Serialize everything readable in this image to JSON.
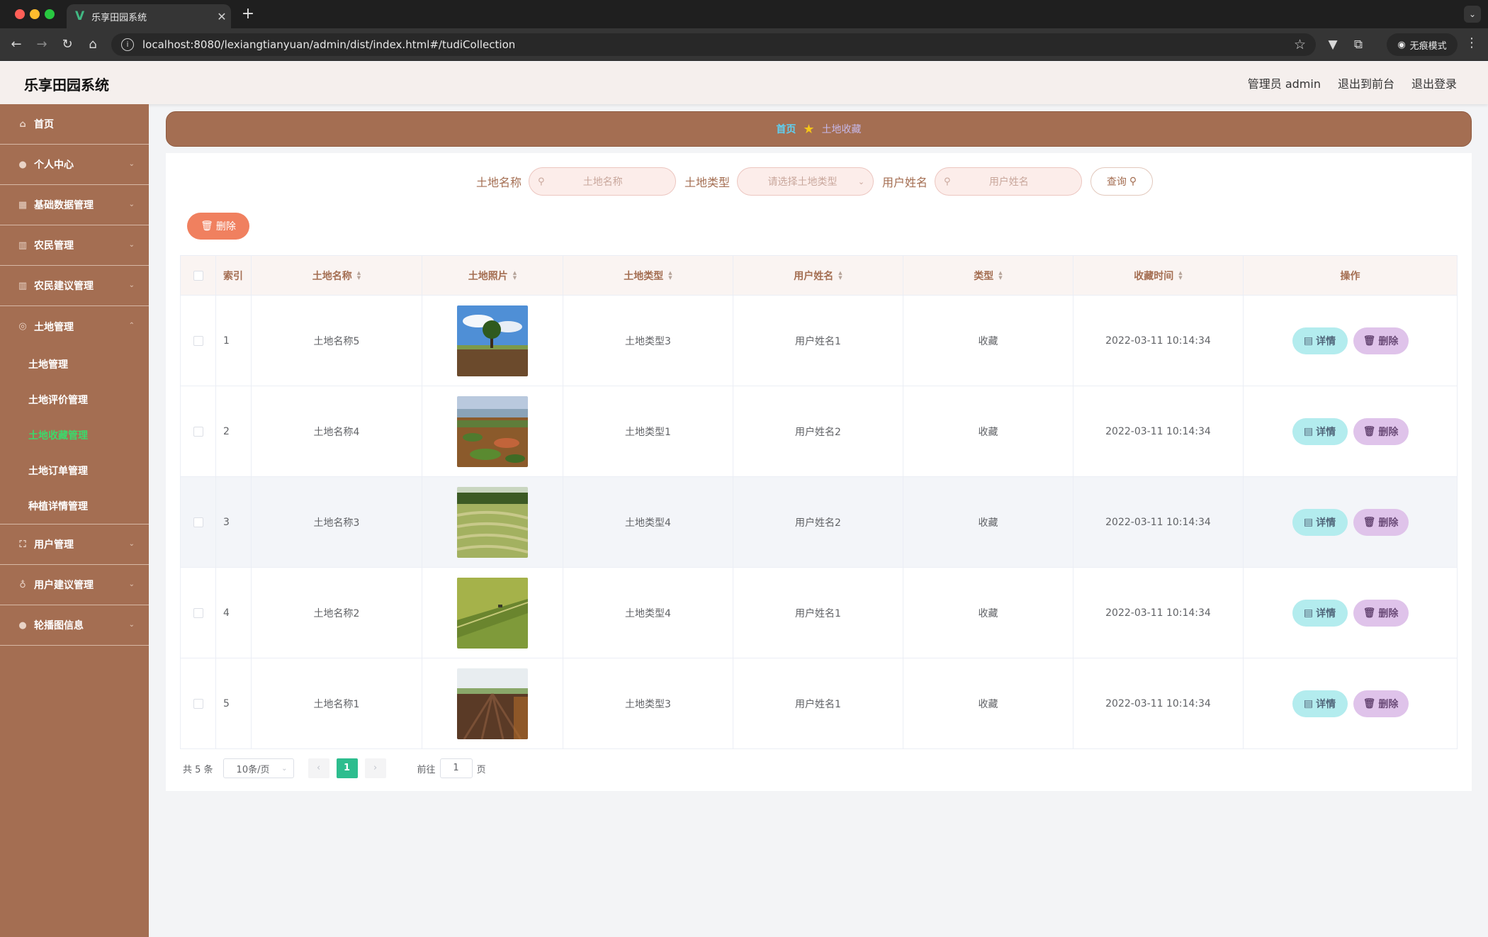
{
  "browser": {
    "tab_title": "乐享田园系统",
    "tab_logo": "V",
    "url": "localhost:8080/lexiangtianyuan/admin/dist/index.html#/tudiCollection",
    "incognito_label": "无痕模式"
  },
  "header": {
    "title": "乐享田园系统",
    "user": "管理员 admin",
    "to_front": "退出到前台",
    "logout": "退出登录"
  },
  "sidebar": {
    "items": [
      {
        "label": "首页",
        "icon": "home-icon"
      },
      {
        "label": "个人中心",
        "icon": "user-icon"
      },
      {
        "label": "基础数据管理",
        "icon": "grid-icon"
      },
      {
        "label": "农民管理",
        "icon": "bar-chart-icon"
      },
      {
        "label": "农民建议管理",
        "icon": "bar-chart-icon"
      },
      {
        "label": "土地管理",
        "icon": "compass-icon"
      },
      {
        "label": "用户管理",
        "icon": "fullscreen-icon"
      },
      {
        "label": "用户建议管理",
        "icon": "bulb-icon"
      },
      {
        "label": "轮播图信息",
        "icon": "user-icon"
      }
    ],
    "land_submenu": [
      "土地管理",
      "土地评价管理",
      "土地收藏管理",
      "土地订单管理",
      "种植详情管理"
    ],
    "active_sub": "土地收藏管理"
  },
  "breadcrumb": {
    "home": "首页",
    "current": "土地收藏"
  },
  "search": {
    "name_label": "土地名称",
    "name_placeholder": "土地名称",
    "type_label": "土地类型",
    "type_placeholder": "请选择土地类型",
    "user_label": "用户姓名",
    "user_placeholder": "用户姓名",
    "query_button": "查询"
  },
  "toolbar": {
    "delete_button": "删除"
  },
  "table": {
    "columns": [
      "索引",
      "土地名称",
      "土地照片",
      "土地类型",
      "用户姓名",
      "类型",
      "收藏时间",
      "操作"
    ],
    "rows": [
      {
        "index": "1",
        "name": "土地名称5",
        "land_type": "土地类型3",
        "user": "用户姓名1",
        "kind": "收藏",
        "time": "2022-03-11 10:14:34"
      },
      {
        "index": "2",
        "name": "土地名称4",
        "land_type": "土地类型1",
        "user": "用户姓名2",
        "kind": "收藏",
        "time": "2022-03-11 10:14:34"
      },
      {
        "index": "3",
        "name": "土地名称3",
        "land_type": "土地类型4",
        "user": "用户姓名2",
        "kind": "收藏",
        "time": "2022-03-11 10:14:34"
      },
      {
        "index": "4",
        "name": "土地名称2",
        "land_type": "土地类型4",
        "user": "用户姓名1",
        "kind": "收藏",
        "time": "2022-03-11 10:14:34"
      },
      {
        "index": "5",
        "name": "土地名称1",
        "land_type": "土地类型3",
        "user": "用户姓名1",
        "kind": "收藏",
        "time": "2022-03-11 10:14:34"
      }
    ],
    "detail_button": "详情",
    "delete_button": "删除"
  },
  "pagination": {
    "total": "共 5 条",
    "page_size": "10条/页",
    "current_page": "1",
    "goto_label": "前往",
    "goto_value": "1",
    "page_suffix": "页"
  }
}
